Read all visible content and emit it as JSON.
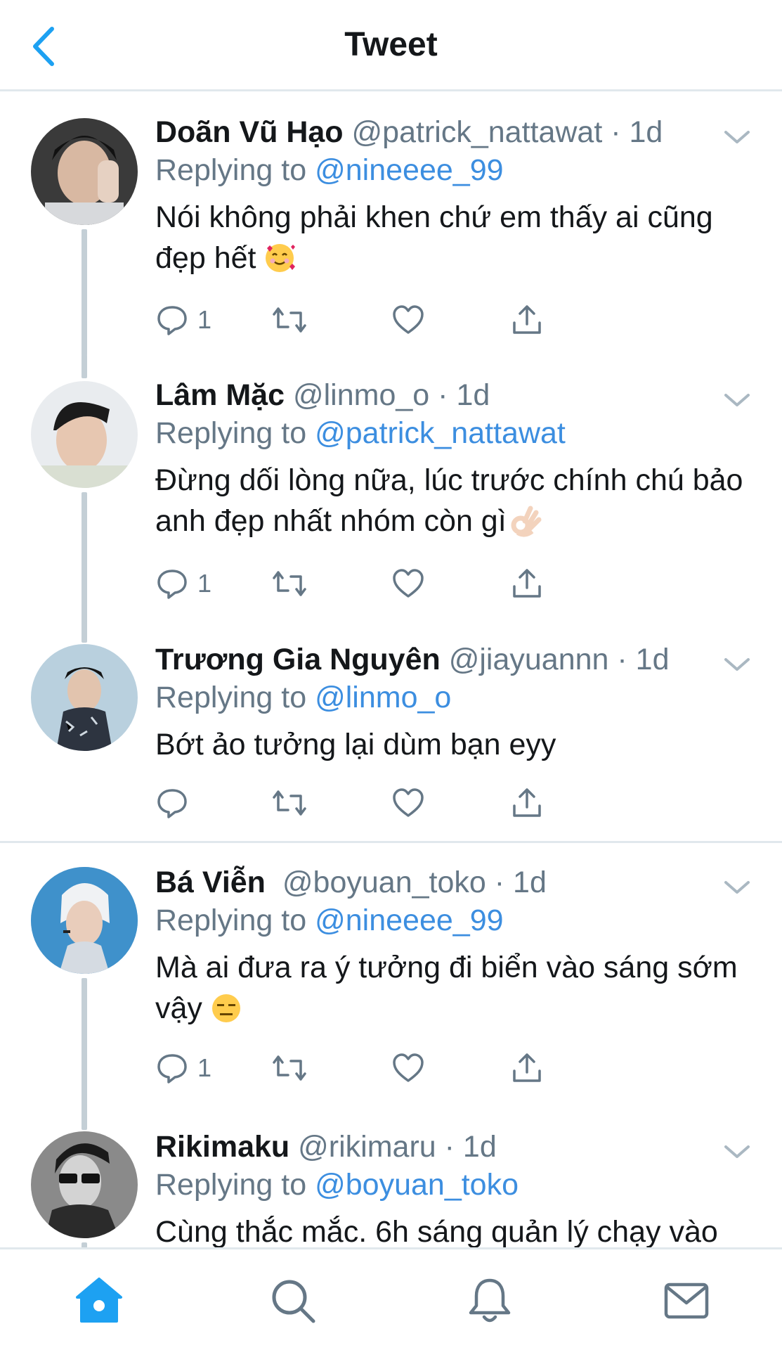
{
  "header": {
    "title": "Tweet",
    "back_icon": "chevron-left-icon"
  },
  "colors": {
    "accent": "#1da1f2",
    "link": "#3c8ee0",
    "muted": "#657786",
    "divider": "#e1e8ed",
    "thread_line": "#c4cfd6"
  },
  "tweets": [
    {
      "name": "Doãn Vũ Hạo",
      "handle": "@patrick_nattawat",
      "time": "1d",
      "replying_prefix": "Replying to",
      "replying_to": "@nineeee_99",
      "text": "Nói không phải khen chứ em thấy ai cũng đẹp hết",
      "emoji": "smiling-face-with-hearts-emoji",
      "reply_count": "1"
    },
    {
      "name": "Lâm Mặc",
      "handle": "@linmo_o",
      "time": "1d",
      "replying_prefix": "Replying to",
      "replying_to": "@patrick_nattawat",
      "text": "Đừng dối lòng nữa, lúc trước chính chú bảo anh đẹp nhất nhóm còn gì",
      "emoji": "ok-hand-emoji",
      "reply_count": "1"
    },
    {
      "name": "Trương Gia Nguyên",
      "handle": "@jiayuannn",
      "time": "1d",
      "replying_prefix": "Replying to",
      "replying_to": "@linmo_o",
      "text": "Bớt ảo tưởng lại dùm bạn eyy",
      "emoji": "",
      "reply_count": ""
    },
    {
      "name": "Bá Viễn",
      "handle": "@boyuan_toko",
      "time": "1d",
      "replying_prefix": "Replying to",
      "replying_to": "@nineeee_99",
      "text": "Mà ai đưa ra ý tưởng đi biển vào sáng sớm vậy",
      "emoji": "expressionless-face-emoji",
      "reply_count": "1"
    },
    {
      "name": "Rikimaku",
      "handle": "@rikimaru",
      "time": "1d",
      "replying_prefix": "Replying to",
      "replying_to": "@boyuan_toko",
      "text": "Cùng thắc mắc. 6h sáng quản lý chạy vào",
      "emoji": "",
      "reply_count": ""
    }
  ],
  "bottom_nav": [
    {
      "name": "home",
      "icon": "home-icon",
      "active": true
    },
    {
      "name": "search",
      "icon": "search-icon",
      "active": false
    },
    {
      "name": "notifications",
      "icon": "bell-icon",
      "active": false
    },
    {
      "name": "messages",
      "icon": "mail-icon",
      "active": false
    }
  ]
}
